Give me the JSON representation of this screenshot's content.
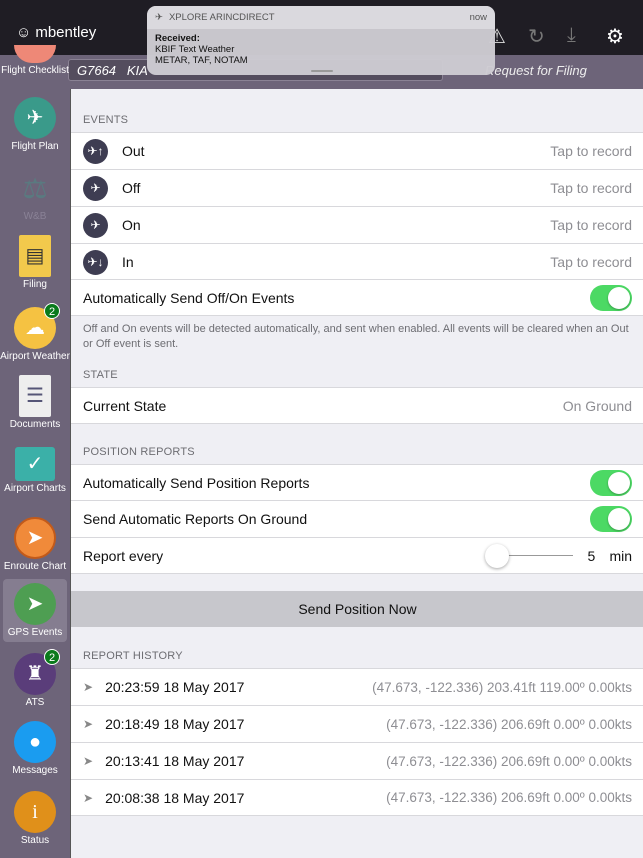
{
  "header": {
    "username": "mbentley",
    "icons": [
      "user-icon",
      "warning-icon",
      "refresh-icon",
      "download-icon",
      "gear-icon"
    ]
  },
  "flight_bar": {
    "flight": "G7664",
    "route": "KIA",
    "status": "Request for Filing"
  },
  "notification": {
    "app": "XPLORE ARINCDIRECT",
    "time": "now",
    "title": "Received:",
    "line1": "KBIF Text Weather",
    "line2": "METAR, TAF, NOTAM"
  },
  "sidebar": {
    "items": [
      {
        "label": "Flight Checklist"
      },
      {
        "label": "Flight Plan"
      },
      {
        "label": "W&B"
      },
      {
        "label": "Filing"
      },
      {
        "label": "Airport Weather",
        "badge": "2"
      },
      {
        "label": "Documents"
      },
      {
        "label": "Airport Charts"
      },
      {
        "label": "Enroute Chart"
      },
      {
        "label": "GPS Events",
        "selected": true
      },
      {
        "label": "ATS",
        "badge": "2"
      },
      {
        "label": "Messages"
      },
      {
        "label": "Status"
      }
    ]
  },
  "events": {
    "header": "EVENTS",
    "rows": [
      {
        "label": "Out",
        "value": "Tap to record"
      },
      {
        "label": "Off",
        "value": "Tap to record"
      },
      {
        "label": "On",
        "value": "Tap to record"
      },
      {
        "label": "In",
        "value": "Tap to record"
      }
    ],
    "auto_label": "Automatically Send Off/On Events",
    "auto_on": true,
    "note": "Off and On events will be detected automatically, and sent when enabled. All events will be cleared when an Out or Off event is sent."
  },
  "state": {
    "header": "STATE",
    "label": "Current State",
    "value": "On Ground"
  },
  "position": {
    "header": "POSITION REPORTS",
    "auto_label": "Automatically Send Position Reports",
    "auto_on": true,
    "ground_label": "Send Automatic Reports On Ground",
    "ground_on": true,
    "every_label": "Report every",
    "every_value": "5",
    "every_unit": "min",
    "slider_fraction": 0
  },
  "send_button": "Send Position Now",
  "history": {
    "header": "REPORT HISTORY",
    "rows": [
      {
        "time": "20:23:59 18 May 2017",
        "detail": "(47.673, -122.336) 203.41ft 119.00º 0.00kts"
      },
      {
        "time": "20:18:49 18 May 2017",
        "detail": "(47.673, -122.336) 206.69ft 0.00º 0.00kts"
      },
      {
        "time": "20:13:41 18 May 2017",
        "detail": "(47.673, -122.336) 206.69ft 0.00º 0.00kts"
      },
      {
        "time": "20:08:38 18 May 2017",
        "detail": "(47.673, -122.336) 206.69ft 0.00º 0.00kts"
      }
    ]
  },
  "colors": {
    "accent_green": "#4cd964",
    "sidebar": "#6d6479",
    "badge": "#0a7a1c"
  }
}
